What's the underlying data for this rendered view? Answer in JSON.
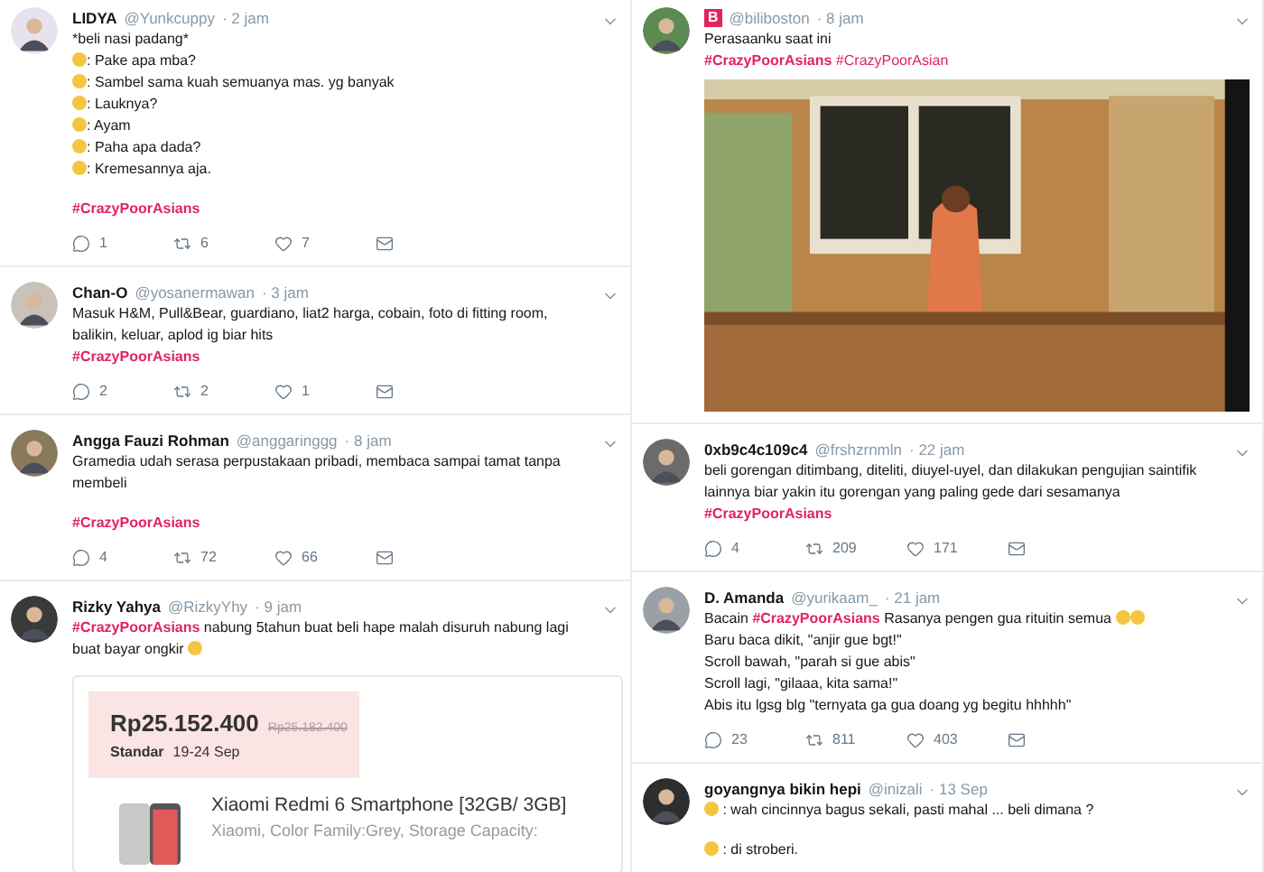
{
  "columns": [
    {
      "tweets": [
        {
          "name": "LIDYA",
          "handle": "@Yunkcuppy",
          "time": "· 2 jam",
          "lines": [
            {
              "segments": [
                {
                  "kind": "text",
                  "text": "*beli nasi padang*"
                }
              ]
            },
            {
              "segments": [
                {
                  "kind": "emoji"
                },
                {
                  "kind": "text",
                  "text": ": Pake apa mba?"
                }
              ]
            },
            {
              "segments": [
                {
                  "kind": "emoji"
                },
                {
                  "kind": "text",
                  "text": ": Sambel sama kuah semuanya mas. yg banyak"
                }
              ]
            },
            {
              "segments": [
                {
                  "kind": "emoji"
                },
                {
                  "kind": "text",
                  "text": ": Lauknya?"
                }
              ]
            },
            {
              "segments": [
                {
                  "kind": "emoji"
                },
                {
                  "kind": "text",
                  "text": ": Ayam"
                }
              ]
            },
            {
              "segments": [
                {
                  "kind": "emoji"
                },
                {
                  "kind": "text",
                  "text": ": Paha apa dada?"
                }
              ]
            },
            {
              "segments": [
                {
                  "kind": "emoji"
                },
                {
                  "kind": "text",
                  "text": ": Kremesannya aja."
                }
              ]
            },
            {
              "space_before": true,
              "segments": [
                {
                  "kind": "tag",
                  "text": "#CrazyPoorAsians"
                }
              ]
            }
          ],
          "actions": {
            "replies": "1",
            "retweets": "6",
            "likes": "7"
          }
        },
        {
          "name": "Chan-O",
          "handle": "@yosanermawan",
          "time": "· 3 jam",
          "lines": [
            {
              "segments": [
                {
                  "kind": "text",
                  "text": "Masuk H&M, Pull&Bear, guardiano, liat2 harga, cobain, foto di fitting room, balikin, keluar, aplod ig biar hits"
                }
              ]
            },
            {
              "segments": [
                {
                  "kind": "tag",
                  "text": "#CrazyPoorAsians"
                }
              ]
            }
          ],
          "actions": {
            "replies": "2",
            "retweets": "2",
            "likes": "1"
          }
        },
        {
          "name": "Angga Fauzi Rohman",
          "handle": "@anggaringgg",
          "time": "· 8 jam",
          "lines": [
            {
              "segments": [
                {
                  "kind": "text",
                  "text": "Gramedia udah serasa perpustakaan pribadi, membaca sampai tamat tanpa membeli"
                }
              ]
            },
            {
              "space_before": true,
              "segments": [
                {
                  "kind": "tag",
                  "text": "#CrazyPoorAsians"
                }
              ]
            }
          ],
          "actions": {
            "replies": "4",
            "retweets": "72",
            "likes": "66"
          }
        },
        {
          "name": "Rizky Yahya",
          "handle": "@RizkyYhy",
          "time": "· 9 jam",
          "lines": [
            {
              "segments": [
                {
                  "kind": "rich",
                  "text": "**#CrazyPoorAsians** nabung 5tahun buat beli hape malah disuruh nabung lagi"
                }
              ]
            },
            {
              "segments": [
                {
                  "kind": "text",
                  "text": "buat bayar ongkir "
                },
                {
                  "kind": "emoji"
                }
              ]
            }
          ],
          "media": {
            "kind": "product",
            "price": "Rp25.152.400",
            "old_price": "Rp25.182.400",
            "shipping": "Standar",
            "dates": "19-24 Sep",
            "title": "Xiaomi Redmi 6 Smartphone [32GB/ 3GB]",
            "description": "Xiaomi, Color Family:Grey, Storage Capacity:"
          }
        }
      ]
    },
    {
      "tweets": [
        {
          "badge": "B",
          "handle": "@biliboston",
          "time": "· 8 jam",
          "lines": [
            {
              "segments": [
                {
                  "kind": "text",
                  "text": "Perasaanku saat ini"
                }
              ]
            },
            {
              "segments": [
                {
                  "kind": "richtag",
                  "text": "**#CrazyPoorAsians** #CrazyPoorAsian"
                }
              ]
            }
          ],
          "media": {
            "kind": "video"
          }
        },
        {
          "name": "0xb9c4c109c4",
          "handle": "@frshzrnmln",
          "time": "· 22 jam",
          "lines": [
            {
              "segments": [
                {
                  "kind": "text",
                  "text": "beli gorengan ditimbang, diteliti, diuyel-uyel, dan dilakukan pengujian saintifik lainnya biar yakin itu gorengan yang paling gede dari sesamanya"
                }
              ]
            },
            {
              "segments": [
                {
                  "kind": "tag",
                  "text": "#CrazyPoorAsians"
                }
              ]
            }
          ],
          "actions": {
            "replies": "4",
            "retweets": "209",
            "likes": "171"
          }
        },
        {
          "name": "D. Amanda",
          "handle": "@yurikaam_",
          "time": "· 21 jam",
          "lines": [
            {
              "segments": [
                {
                  "kind": "rich",
                  "text": "Bacain **#CrazyPoorAsians** Rasanya pengen gua rituitin semua "
                },
                {
                  "kind": "emoji"
                },
                {
                  "kind": "emoji"
                }
              ]
            },
            {
              "segments": [
                {
                  "kind": "text",
                  "text": "Baru baca dikit, \"anjir gue bgt!\""
                }
              ]
            },
            {
              "segments": [
                {
                  "kind": "text",
                  "text": "Scroll bawah, \"parah si gue abis\""
                }
              ]
            },
            {
              "segments": [
                {
                  "kind": "text",
                  "text": "Scroll lagi, \"gilaaa, kita sama!\""
                }
              ]
            },
            {
              "segments": [
                {
                  "kind": "text",
                  "text": "Abis itu lgsg blg \"ternyata ga gua doang yg begitu hhhhh\""
                }
              ]
            }
          ],
          "actions": {
            "replies": "23",
            "retweets": "811",
            "likes": "403"
          }
        },
        {
          "name": "goyangnya bikin hepi",
          "handle": "@inizali",
          "time": "· 13 Sep",
          "lines": [
            {
              "segments": [
                {
                  "kind": "emoji"
                },
                {
                  "kind": "text",
                  "text": " : wah cincinnya bagus sekali, pasti mahal ... beli dimana ?"
                }
              ]
            },
            {
              "space_before": true,
              "segments": [
                {
                  "kind": "emoji"
                },
                {
                  "kind": "text",
                  "text": " : di stroberi."
                }
              ]
            }
          ]
        }
      ]
    }
  ]
}
